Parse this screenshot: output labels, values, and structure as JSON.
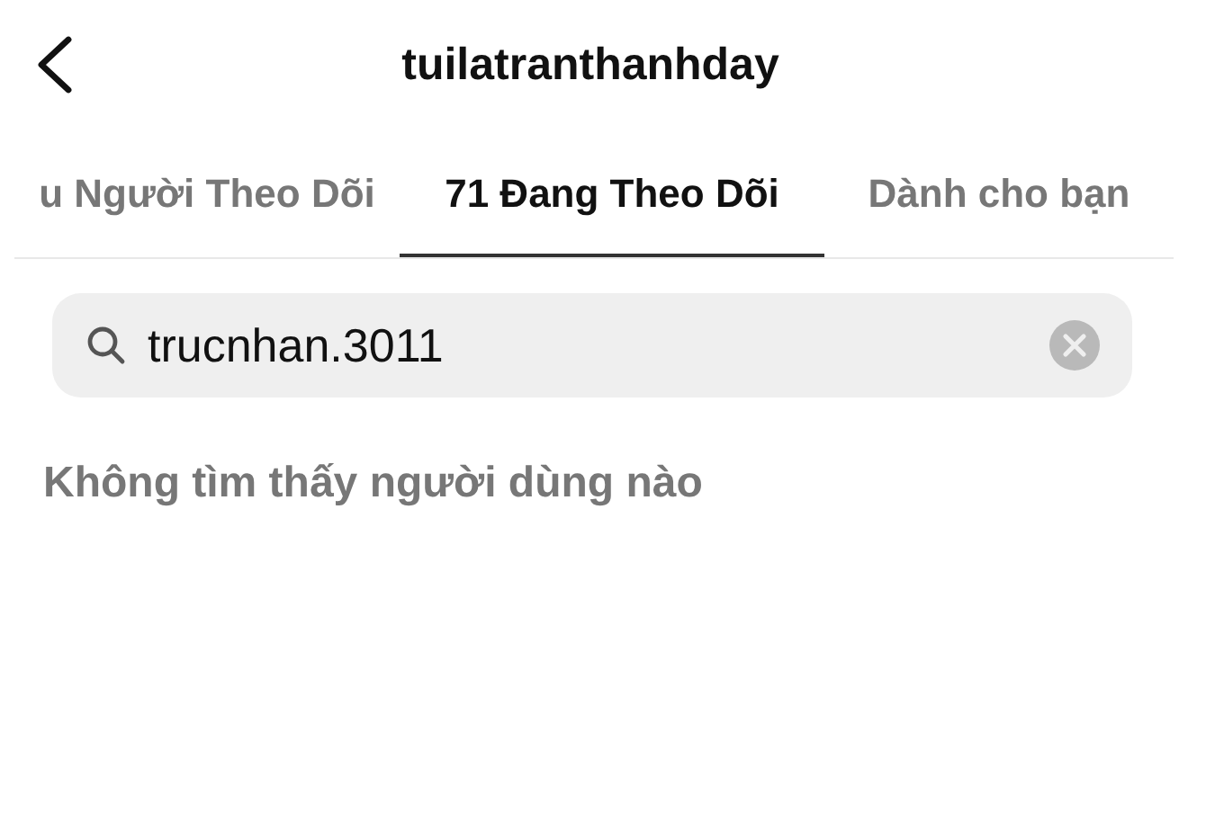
{
  "header": {
    "title": "tuilatranthanhday"
  },
  "tabs": [
    {
      "label": "u Người Theo Dõi",
      "selected": false
    },
    {
      "label": "71 Đang Theo Dõi",
      "selected": true
    },
    {
      "label": "Dành cho bạn",
      "selected": false
    }
  ],
  "search": {
    "value": "trucnhan.3011"
  },
  "message": "Không tìm thấy người dùng nào"
}
